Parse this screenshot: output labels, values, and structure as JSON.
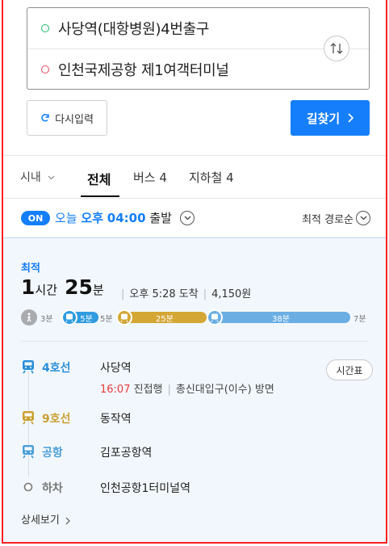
{
  "search": {
    "origin": "사당역(대항병원)4번출구",
    "destination": "인천국제공항 제1여객터미널",
    "reset_label": "다시입력",
    "find_label": "길찾기"
  },
  "tabs": {
    "city": "시내",
    "all": "전체",
    "bus": "버스 4",
    "subway": "지하철 4"
  },
  "departure": {
    "on_badge": "ON",
    "day": "오늘",
    "ampm": "오후",
    "time": "04:00",
    "suffix": "출발",
    "sort_label": "최적 경로순"
  },
  "result": {
    "badge": "최적",
    "hours": "1",
    "hours_unit": "시간",
    "minutes": "25",
    "minutes_unit": "분",
    "arrival": "오후 5:28 도착",
    "fare": "4,150원",
    "timeline": {
      "walk_start": "3분",
      "seg1": "5분",
      "walk_mid": "5분",
      "seg2": "25분",
      "seg3": "38분",
      "walk_end": "7분"
    },
    "steps": [
      {
        "line": "4호선",
        "station": "사당역",
        "color": "#2b8fd9"
      },
      {
        "line": "9호선",
        "station": "동작역",
        "color": "#c9a132"
      },
      {
        "line": "공항",
        "station": "김포공항역",
        "color": "#4d9fd8"
      },
      {
        "line": "하차",
        "station": "인천공항1터미널역",
        "color": "#777777"
      }
    ],
    "step1_detail": {
      "time": "16:07",
      "direction": "진접행",
      "exit": "총신대입구(이수) 방면"
    },
    "timetable_label": "시간표",
    "detail_link": "상세보기"
  },
  "colors": {
    "line4": "#2f9be0",
    "line9": "#d4a634",
    "airport": "#6aaee4",
    "accent": "#157efb"
  }
}
